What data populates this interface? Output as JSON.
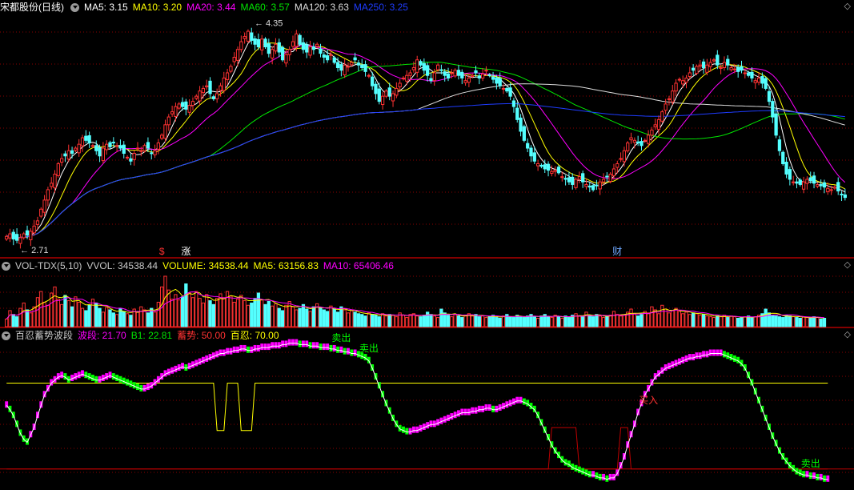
{
  "colors": {
    "up": "#ff3232",
    "down": "#54ffff",
    "ma5": "#ffffff",
    "ma10": "#ffff00",
    "ma20": "#ff00ff",
    "ma60": "#00e600",
    "ma120": "#dcdcdc",
    "ma250": "#1e3cff",
    "grid": "#8b0000"
  },
  "price_panel": {
    "stock_title": "宋都股份(日线)",
    "ma_labels": [
      {
        "text": "MA5: 3.15",
        "color": "#ffffff"
      },
      {
        "text": "MA10: 3.20",
        "color": "#ffff00"
      },
      {
        "text": "MA20: 3.44",
        "color": "#ff00ff"
      },
      {
        "text": "MA60: 3.57",
        "color": "#00e600"
      },
      {
        "text": "MA120: 3.63",
        "color": "#dcdcdc"
      },
      {
        "text": "MA250: 3.25",
        "color": "#1e3cff"
      }
    ],
    "high_label": "4.35",
    "low_label": "2.71",
    "markers": [
      {
        "text": "$",
        "color": "#ff3232",
        "bar": 45
      },
      {
        "text": "涨",
        "color": "#ffffff",
        "bar": 52
      },
      {
        "text": "财",
        "color": "#6fa8ff",
        "bar": 177
      }
    ]
  },
  "volume_panel": {
    "title": "VOL-TDX(5,10)",
    "labels": [
      {
        "text": "VVOL: 34538.44",
        "color": "#c8c8c8"
      },
      {
        "text": "VOLUME: 34538.44",
        "color": "#ffff00"
      },
      {
        "text": "MA5: 63156.83",
        "color": "#ffff00"
      },
      {
        "text": "MA10: 65406.46",
        "color": "#ff00ff"
      }
    ]
  },
  "indicator_panel": {
    "title": "百忍蓄势波段",
    "labels": [
      {
        "text": "波段: 21.70",
        "color": "#ff00ff"
      },
      {
        "text": "B1: 22.81",
        "color": "#00e600"
      },
      {
        "text": "蓄势: 50.00",
        "color": "#ff3232"
      },
      {
        "text": "百忍: 70.00",
        "color": "#ffff00"
      }
    ],
    "signals": [
      {
        "text": "卖出",
        "bar": 97
      },
      {
        "text": "卖出",
        "bar": 105
      },
      {
        "text": "卖出",
        "bar": 233
      },
      {
        "text": "买入",
        "bar": 186
      }
    ]
  },
  "chart_data": {
    "type": "candlestick",
    "price_range": [
      2.6,
      4.45
    ],
    "closes": [
      2.74,
      2.76,
      2.72,
      2.71,
      2.73,
      2.76,
      2.75,
      2.78,
      2.82,
      2.86,
      2.95,
      3.02,
      3.1,
      3.15,
      3.22,
      3.3,
      3.34,
      3.36,
      3.4,
      3.38,
      3.42,
      3.45,
      3.5,
      3.48,
      3.46,
      3.44,
      3.4,
      3.36,
      3.42,
      3.45,
      3.43,
      3.46,
      3.44,
      3.42,
      3.38,
      3.35,
      3.32,
      3.38,
      3.42,
      3.4,
      3.44,
      3.42,
      3.38,
      3.4,
      3.46,
      3.52,
      3.6,
      3.66,
      3.7,
      3.74,
      3.76,
      3.74,
      3.72,
      3.75,
      3.78,
      3.82,
      3.86,
      3.88,
      3.9,
      3.84,
      3.8,
      3.84,
      3.9,
      3.96,
      4,
      4.05,
      4.12,
      4.18,
      4.24,
      4.28,
      4.32,
      4.25,
      4.22,
      4.2,
      4.26,
      4.2,
      4.15,
      4.18,
      4.22,
      4.16,
      4.1,
      4.14,
      4.18,
      4.24,
      4.3,
      4.22,
      4.18,
      4.16,
      4.2,
      4.18,
      4.22,
      4.15,
      4.12,
      4.1,
      4.14,
      4.08,
      4.04,
      4.02,
      4.06,
      4.05,
      4.08,
      4.1,
      4.06,
      4.04,
      4.01,
      3.98,
      3.9,
      3.84,
      3.78,
      3.82,
      3.86,
      3.82,
      3.84,
      3.88,
      3.92,
      3.96,
      3.98,
      4,
      4.04,
      4.1,
      4.06,
      4.02,
      3.98,
      3.94,
      4,
      4.06,
      4.02,
      3.98,
      3.96,
      4,
      4.02,
      3.98,
      3.96,
      3.94,
      3.96,
      3.98,
      4,
      3.96,
      3.99,
      4.02,
      3.98,
      3.95,
      3.92,
      3.9,
      3.88,
      3.86,
      3.82,
      3.74,
      3.64,
      3.55,
      3.48,
      3.42,
      3.36,
      3.32,
      3.3,
      3.28,
      3.26,
      3.25,
      3.24,
      3.25,
      3.23,
      3.2,
      3.18,
      3.16,
      3.14,
      3.18,
      3.2,
      3.16,
      3.14,
      3.12,
      3.1,
      3.13,
      3.16,
      3.18,
      3.2,
      3.22,
      3.26,
      3.3,
      3.34,
      3.4,
      3.46,
      3.5,
      3.48,
      3.46,
      3.44,
      3.48,
      3.52,
      3.56,
      3.6,
      3.64,
      3.7,
      3.76,
      3.8,
      3.86,
      3.92,
      3.95,
      3.94,
      3.96,
      4,
      4.02,
      4.05,
      4.06,
      4.04,
      4.06,
      4.08,
      4.1,
      4.06,
      4.04,
      4.08,
      4.06,
      4.04,
      4.03,
      4.01,
      4.02,
      4,
      3.98,
      3.96,
      3.94,
      3.96,
      3.92,
      3.88,
      3.78,
      3.66,
      3.52,
      3.4,
      3.3,
      3.22,
      3.18,
      3.16,
      3.15,
      3.14,
      3.16,
      3.18,
      3.17,
      3.15,
      3.14,
      3.13,
      3.12,
      3.11,
      3.1,
      3.12,
      3.09,
      3.06,
      3.04
    ],
    "overlay_lines": [
      "MA5",
      "MA10",
      "MA20",
      "MA60",
      "MA120",
      "MA250"
    ],
    "volume_levels": [
      1,
      2.1,
      1.6,
      1.3,
      2.4,
      3.1,
      2.2,
      1.8,
      2.6,
      3.8,
      4.6,
      3.2,
      2.8,
      4.4,
      5.2,
      3.6,
      2.9,
      4.1,
      3.4,
      2.6,
      3.9,
      3.2,
      2.4,
      2.1,
      2.8,
      3.6,
      3.1,
      2.4,
      1.9,
      2.5,
      2.2,
      1.8,
      1.6,
      2.4,
      2.0,
      1.7,
      1.5,
      2.3,
      1.9,
      2.6,
      2.2,
      1.8,
      2.4,
      1.9,
      3.2,
      5.2,
      6.6,
      4.8,
      3.6,
      4.2,
      3.5,
      3.9,
      5.6,
      4.4,
      3.8,
      4.6,
      3.7,
      3.1,
      4.2,
      3.4,
      2.9,
      3.7,
      4.3,
      3.8,
      4.6,
      4.0,
      3.2,
      3.6,
      4.1,
      3.4,
      2.8,
      3.1,
      3.7,
      4.4,
      3.5,
      2.9,
      3.3,
      2.7,
      3.0,
      2.4,
      2.1,
      2.8,
      3.3,
      2.6,
      2.2,
      2.4,
      2.9,
      2.3,
      2.0,
      2.6,
      3.0,
      2.5,
      2.2,
      2.0,
      2.7,
      2.3,
      1.9,
      2.6,
      2.2,
      1.8,
      2.1,
      1.9,
      1.7,
      1.6,
      1.4,
      1.8,
      1.6,
      1.5,
      1.3,
      1.7,
      1.4,
      1.6,
      1.5,
      1.3,
      1.8,
      1.5,
      1.2,
      1.6,
      1.7,
      1.4,
      1.3,
      1.5,
      1.9,
      1.6,
      1.4,
      1.2,
      2.3,
      1.8,
      1.5,
      1.3,
      1.6,
      1.4,
      1.2,
      1.5,
      1.7,
      1.4,
      1.6,
      1.3,
      1.4,
      1.2,
      1.3,
      1.5,
      1.2,
      1.1,
      1.4,
      1.6,
      1.3,
      1.2,
      1.5,
      1.3,
      1.2,
      1.4,
      1.6,
      1.3,
      1.1,
      1.4,
      1.6,
      1.3,
      1.2,
      1.5,
      1.3,
      1.1,
      1.4,
      1.2,
      1.5,
      1.7,
      1.4,
      1.3,
      1.9,
      1.5,
      1.3,
      1.6,
      1.4,
      1.2,
      1.3,
      1.5,
      2.0,
      1.6,
      1.4,
      1.5,
      1.9,
      2.3,
      1.7,
      1.4,
      1.6,
      2.0,
      1.8,
      2.6,
      2.2,
      1.7,
      2.8,
      2.3,
      1.8,
      2.1,
      2.4,
      2.0,
      1.7,
      1.9,
      1.6,
      1.8,
      1.7,
      1.5,
      1.6,
      1.4,
      1.3,
      1.2,
      1.4,
      1.3,
      1.5,
      1.2,
      1.4,
      1.3,
      1.1,
      1.2,
      1.3,
      1.4,
      1.2,
      1.3,
      1.5,
      1.7,
      2.3,
      1.8,
      1.5,
      1.4,
      1.3,
      1.2,
      1.5,
      1.4,
      1.3,
      1.2,
      1.1,
      1.3,
      1.2,
      1.1,
      1.3,
      1.2,
      1.0,
      1.1
    ],
    "wave_values": [
      55,
      52,
      48,
      42,
      36,
      32,
      30,
      35,
      40,
      48,
      55,
      62,
      66,
      70,
      72,
      74,
      75,
      74,
      72,
      73,
      74,
      75,
      76,
      75,
      74,
      73,
      72,
      72,
      73,
      74,
      75,
      74,
      73,
      72,
      71,
      70,
      69,
      68,
      67,
      66,
      66,
      67,
      68,
      70,
      72,
      74,
      76,
      77,
      78,
      79,
      80,
      81,
      80,
      81,
      82,
      83,
      84,
      85,
      86,
      87,
      88,
      89,
      90,
      90,
      91,
      91,
      92,
      92,
      93,
      93,
      92,
      92,
      93,
      93,
      94,
      94,
      94,
      95,
      95,
      95,
      96,
      96,
      97,
      97,
      97,
      96,
      96,
      96,
      95,
      95,
      95,
      94,
      94,
      94,
      93,
      93,
      92,
      92,
      91,
      91,
      90,
      90,
      89,
      88,
      87,
      85,
      80,
      74,
      68,
      62,
      56,
      51,
      46,
      42,
      39,
      38,
      37,
      37,
      38,
      38,
      39,
      40,
      41,
      42,
      42,
      43,
      44,
      45,
      46,
      47,
      48,
      49,
      50,
      50,
      50,
      51,
      51,
      52,
      52,
      53,
      53,
      52,
      52,
      53,
      54,
      55,
      56,
      57,
      58,
      58,
      57,
      56,
      54,
      52,
      48,
      43,
      38,
      33,
      28,
      24,
      21,
      18,
      16,
      15,
      13,
      12,
      11,
      10,
      9,
      8,
      8,
      7,
      6,
      6,
      5,
      6,
      6,
      9,
      14,
      20,
      28,
      35,
      42,
      50,
      56,
      62,
      66,
      70,
      74,
      76,
      78,
      80,
      81,
      82,
      83,
      84,
      85,
      86,
      87,
      87,
      88,
      88,
      89,
      89,
      90,
      90,
      90,
      90,
      89,
      88,
      87,
      86,
      85,
      83,
      80,
      75,
      70,
      64,
      58,
      52,
      46,
      40,
      34,
      29,
      24,
      20,
      17,
      14,
      12,
      10,
      9,
      8,
      8,
      7,
      7,
      6,
      6,
      5,
      5
    ],
    "reference_levels": {
      "bairen": 70,
      "xushi": 50
    },
    "bairen_dips_to": 38,
    "xushi_peaks_to": 40
  }
}
